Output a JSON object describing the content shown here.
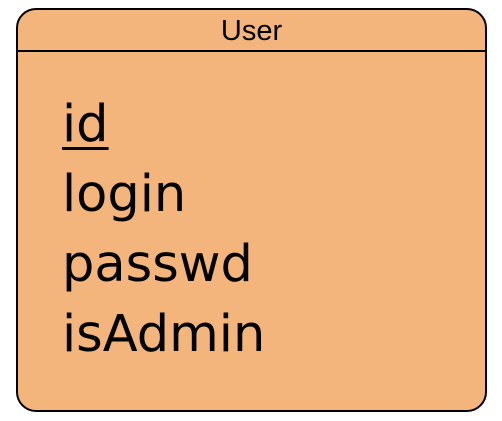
{
  "entity": {
    "name": "User",
    "fill_color": "#f4b57c",
    "border_color": "#000000",
    "attributes": [
      {
        "name": "id",
        "primary_key": true
      },
      {
        "name": "login",
        "primary_key": false
      },
      {
        "name": "passwd",
        "primary_key": false
      },
      {
        "name": "isAdmin",
        "primary_key": false
      }
    ]
  }
}
